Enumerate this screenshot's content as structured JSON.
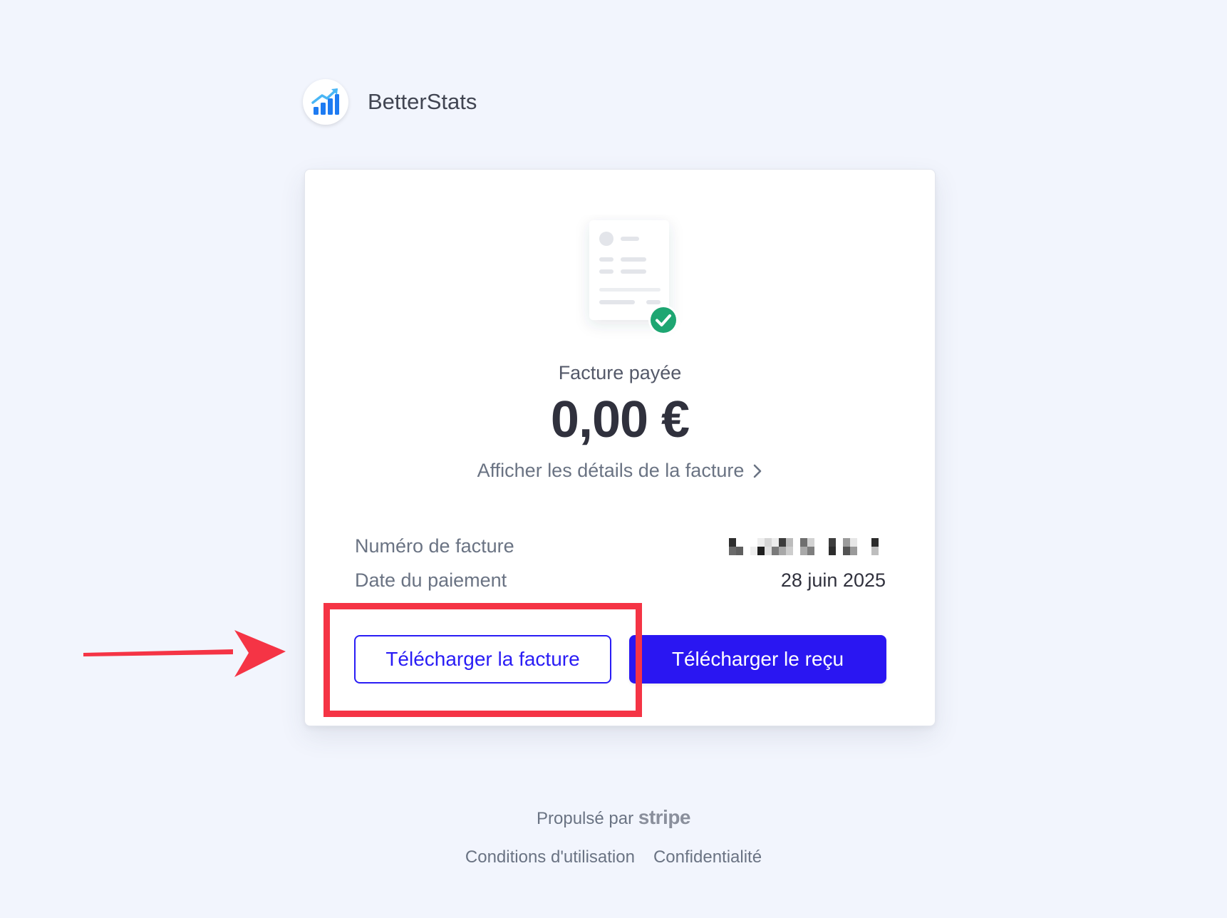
{
  "brand": {
    "name": "BetterStats",
    "logo_icon": "bar-chart-rising-arrow-icon",
    "logo_color": "#1e7bf2"
  },
  "invoice": {
    "status_text": "Facture payée",
    "amount": "0,00 €",
    "details_link": "Afficher les détails de la facture",
    "fields": [
      {
        "label": "Numéro de facture",
        "value": "[redacted]"
      },
      {
        "label": "Date du paiement",
        "value": "28 juin 2025"
      }
    ],
    "download_invoice_label": "Télécharger la facture",
    "download_receipt_label": "Télécharger le reçu",
    "paid_check_color": "#1ea672",
    "accent_color": "#2a16f2"
  },
  "annotation": {
    "highlight_color": "#f53445",
    "highlight_target": "download-invoice-button"
  },
  "footer": {
    "powered_by": "Propulsé par",
    "powered_by_brand": "stripe",
    "links": [
      "Conditions d'utilisation",
      "Confidentialité"
    ]
  }
}
